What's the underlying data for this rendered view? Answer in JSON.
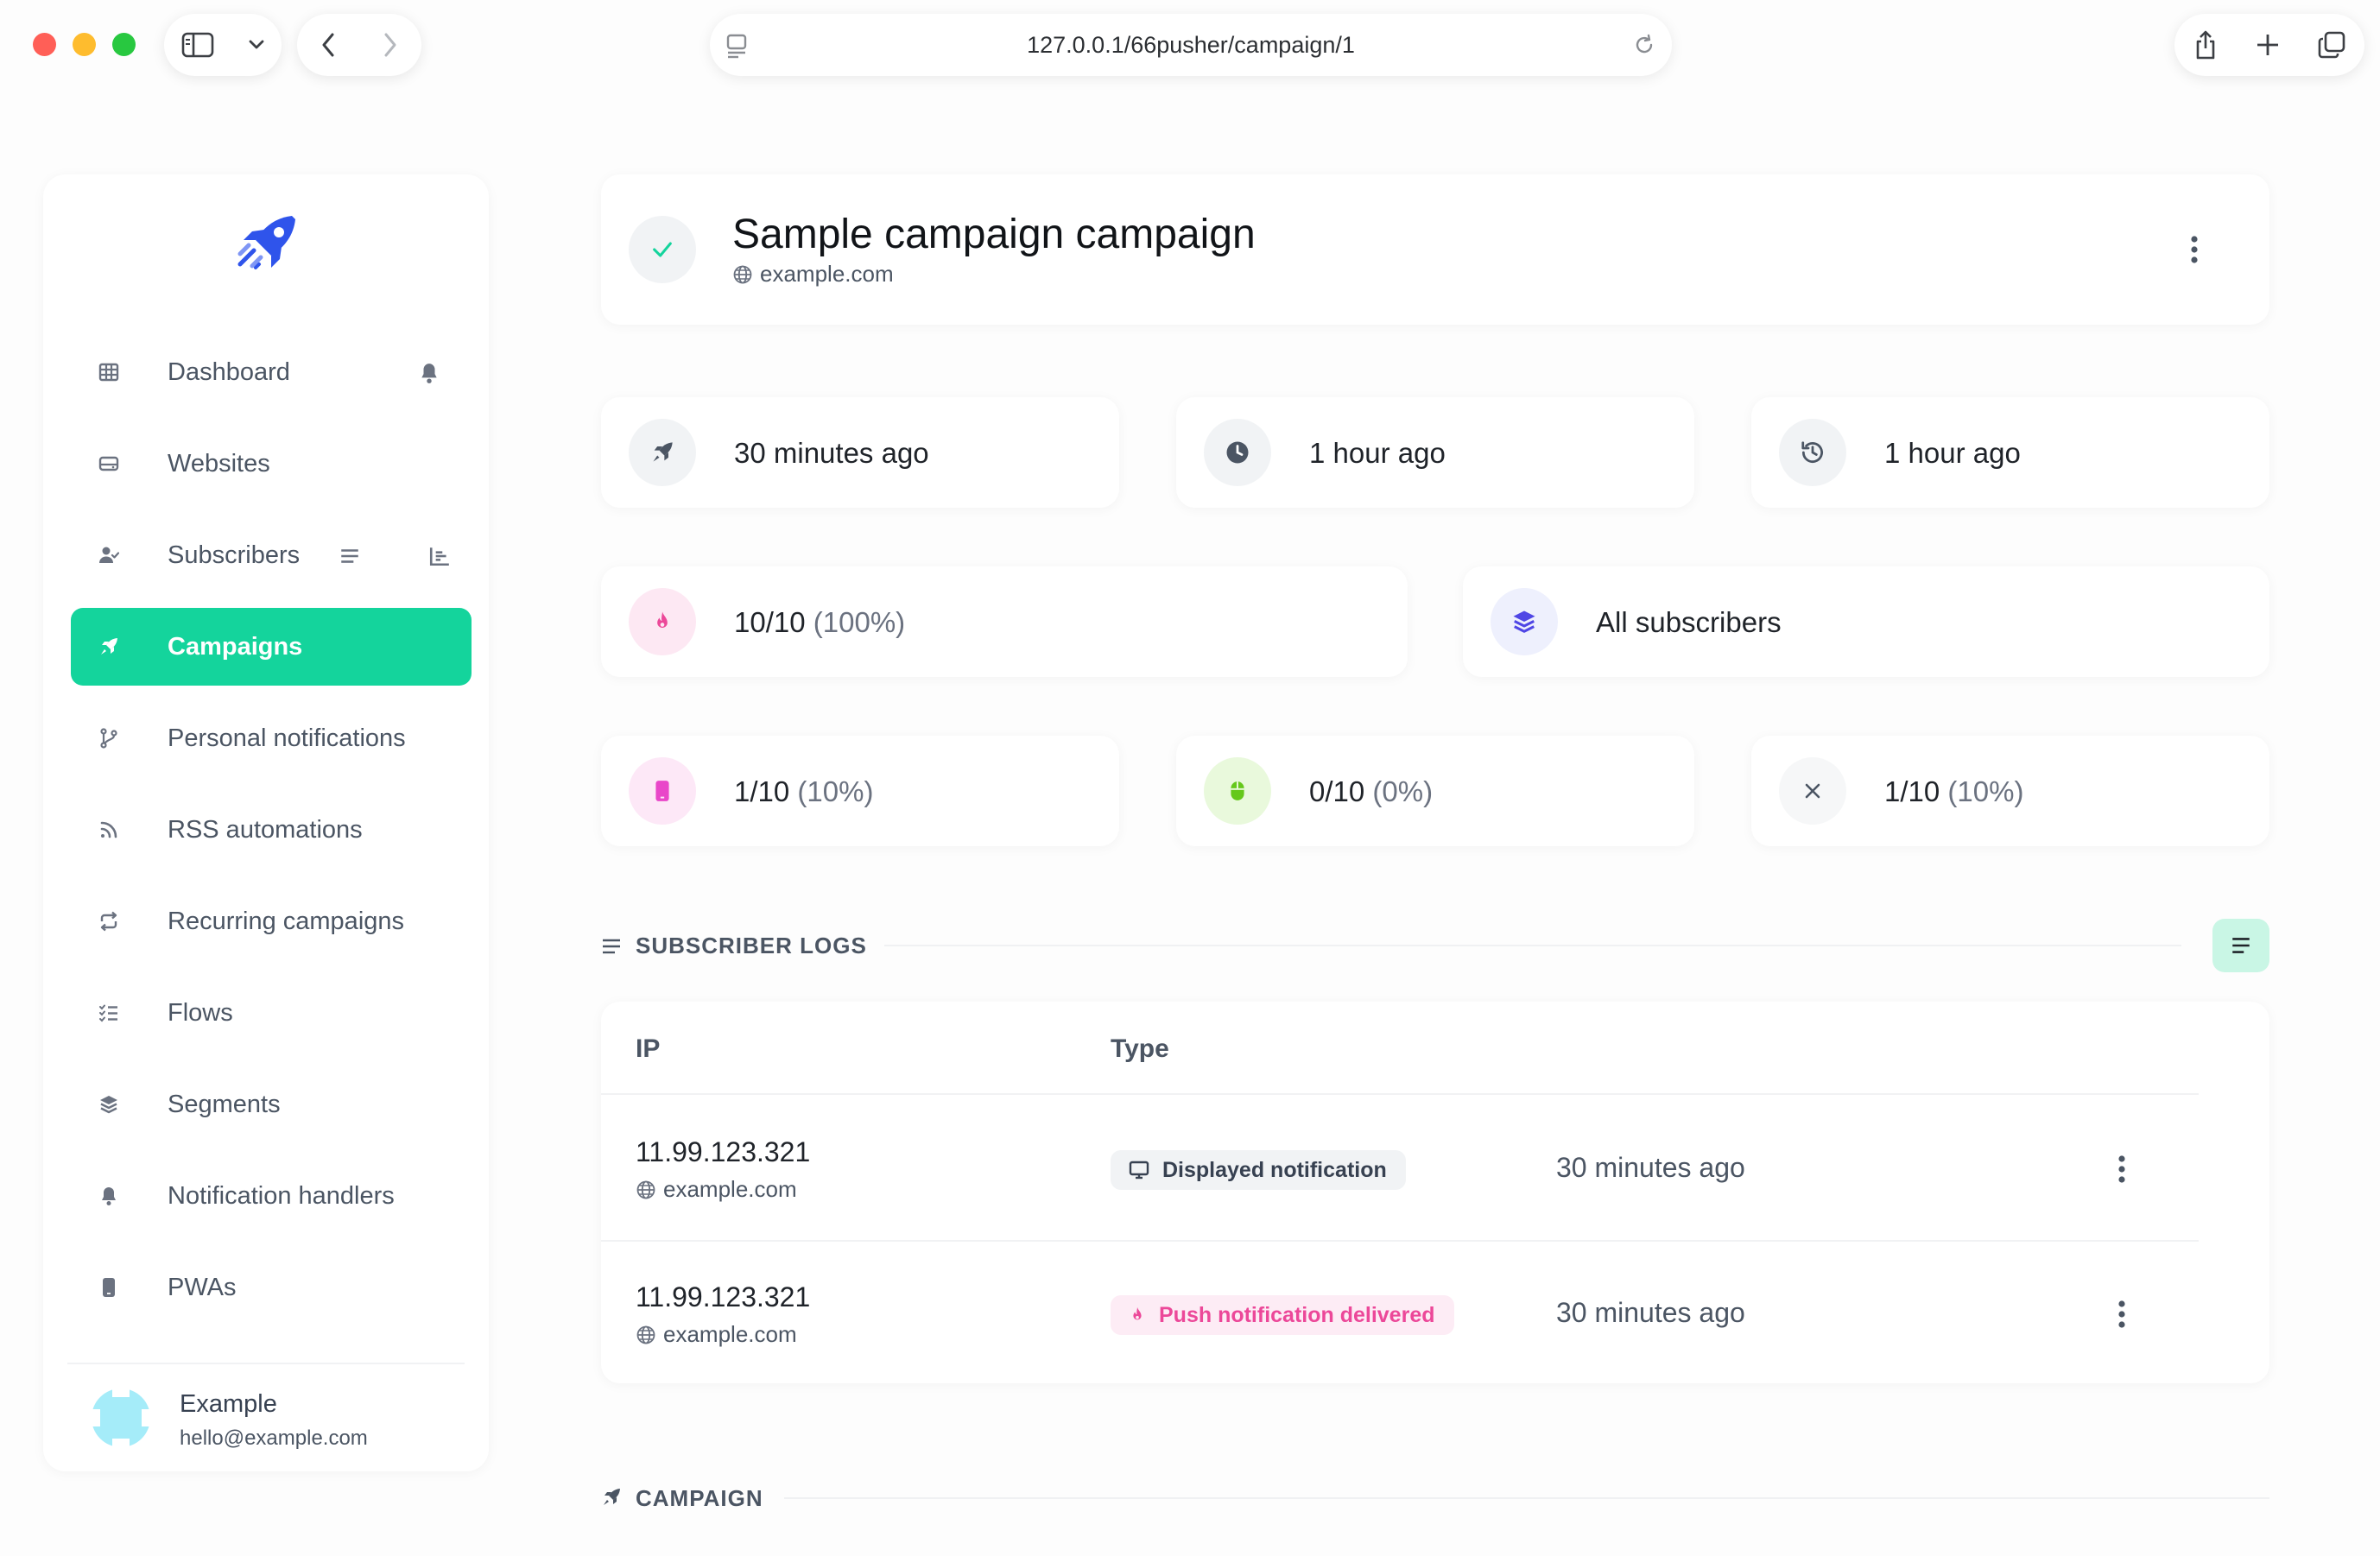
{
  "browser": {
    "url": "127.0.0.1/66pusher/campaign/1"
  },
  "sidebar": {
    "items": [
      {
        "label": "Dashboard",
        "icon": "table-icon"
      },
      {
        "label": "Websites",
        "icon": "hard-drive-icon"
      },
      {
        "label": "Subscribers",
        "icon": "user-check-icon"
      },
      {
        "label": "Campaigns",
        "icon": "rocket-icon",
        "active": true
      },
      {
        "label": "Personal notifications",
        "icon": "branch-icon"
      },
      {
        "label": "RSS automations",
        "icon": "rss-icon"
      },
      {
        "label": "Recurring campaigns",
        "icon": "repeat-icon"
      },
      {
        "label": "Flows",
        "icon": "list-check-icon"
      },
      {
        "label": "Segments",
        "icon": "layers-icon"
      },
      {
        "label": "Notification handlers",
        "icon": "bell-icon"
      },
      {
        "label": "PWAs",
        "icon": "mobile-icon"
      }
    ],
    "user": {
      "name": "Example",
      "email": "hello@example.com"
    }
  },
  "header": {
    "title": "Sample campaign campaign",
    "domain": "example.com"
  },
  "stats": {
    "sent": "30 minutes ago",
    "scheduled": "1 hour ago",
    "updated": "1 hour ago",
    "delivered": {
      "value": "10/10",
      "pct": "(100%)"
    },
    "segment": "All subscribers",
    "displayed": {
      "value": "1/10",
      "pct": "(10%)"
    },
    "clicked": {
      "value": "0/10",
      "pct": "(0%)"
    },
    "closed": {
      "value": "1/10",
      "pct": "(10%)"
    }
  },
  "logs": {
    "section_title": "SUBSCRIBER LOGS",
    "columns": {
      "ip": "IP",
      "type": "Type"
    },
    "rows": [
      {
        "ip": "11.99.123.321",
        "domain": "example.com",
        "type": "Displayed notification",
        "time": "30 minutes ago"
      },
      {
        "ip": "11.99.123.321",
        "domain": "example.com",
        "type": "Push notification delivered",
        "time": "30 minutes ago"
      }
    ]
  },
  "campaign_section": {
    "title": "CAMPAIGN"
  },
  "colors": {
    "accent": "#14d49c",
    "pink": "#ec4899",
    "lime": "#84cc16",
    "indigo": "#4f46e5"
  }
}
